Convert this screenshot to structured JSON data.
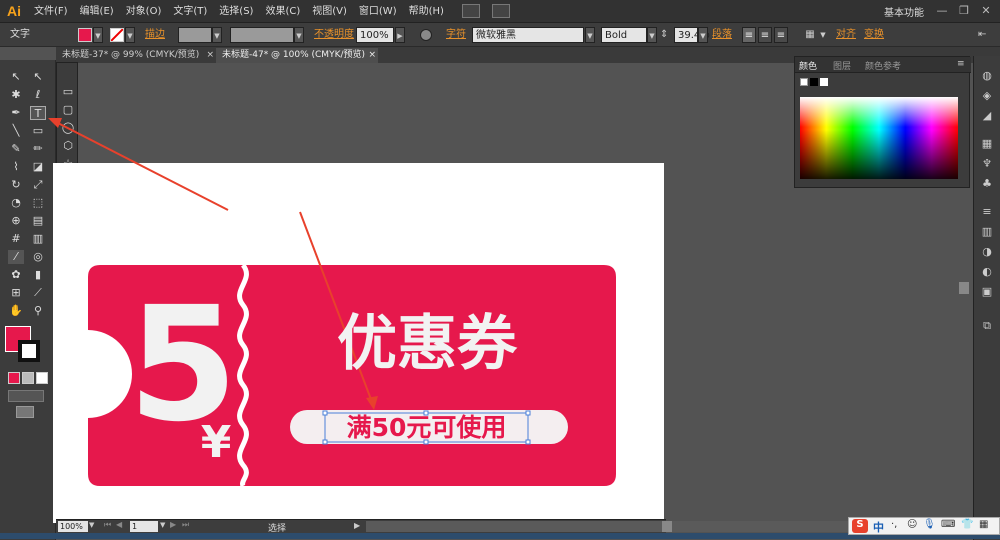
{
  "app": {
    "logo": "Ai",
    "workspace": "基本功能"
  },
  "menu": [
    "文件(F)",
    "编辑(E)",
    "对象(O)",
    "文字(T)",
    "选择(S)",
    "效果(C)",
    "视图(V)",
    "窗口(W)",
    "帮助(H)"
  ],
  "window_controls": {
    "minimize": "—",
    "restore": "❐",
    "close": "✕"
  },
  "control_bar": {
    "tool_label": "文字",
    "stroke_label": "描边",
    "opacity_label": "不透明度",
    "opacity_value": "100%",
    "char_label": "字符",
    "font_name": "微软雅黑",
    "font_style": "Bold",
    "font_size": "39.4 p",
    "paragraph_label": "段落",
    "align_label": "对齐",
    "transform_label": "变换"
  },
  "tabs": [
    {
      "label": "未标题-37* @ 99% (CMYK/预览)",
      "close": "×"
    },
    {
      "label": "未标题-47* @ 100% (CMYK/预览)",
      "close": "×"
    }
  ],
  "color_panel": {
    "tabs": [
      "颜色",
      "图层",
      "颜色参考"
    ],
    "menu_icon": "≡"
  },
  "coupon": {
    "amount": "5",
    "currency": "¥",
    "title": "优惠券",
    "condition": "满50元可使用",
    "color": "#e6184c"
  },
  "status": {
    "zoom": "100%",
    "page": "1",
    "tool": "选择"
  },
  "ime": {
    "brand": "S",
    "lang": "中"
  },
  "colors": {
    "fill": "#e6184c",
    "accent_orange": "#e8912a",
    "arrow": "#e8412c"
  }
}
